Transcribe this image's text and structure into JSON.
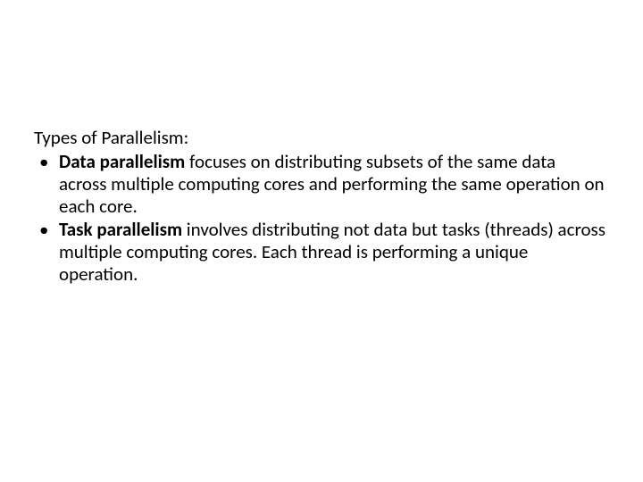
{
  "slide": {
    "heading": "Types of Parallelism:",
    "bullets": [
      {
        "term": "Data parallelism",
        "rest": " focuses on distributing subsets of the same data across multiple computing cores and performing the same operation on each core."
      },
      {
        "term": "Task parallelism",
        "rest": " involves distributing not data but tasks (threads) across multiple computing cores. Each thread is performing a unique operation."
      }
    ]
  }
}
